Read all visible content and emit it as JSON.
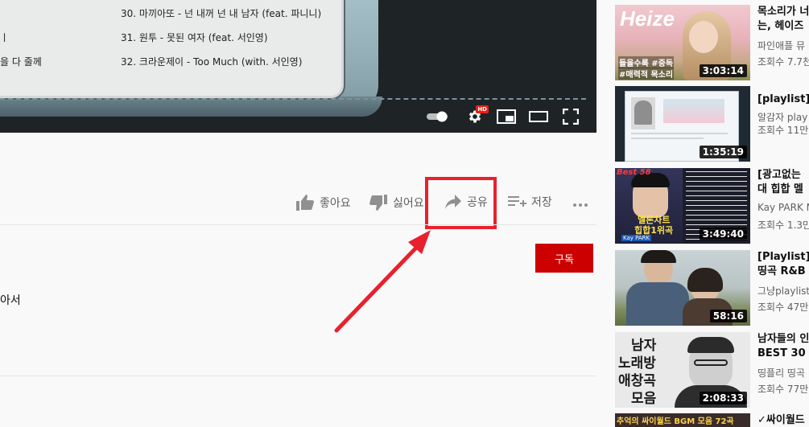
{
  "player": {
    "tracks": [
      {
        "label": "30. 마끼아또 - 넌 내꺼 넌 내 남자 (feat. 파니니)"
      },
      {
        "label": "31. 원투 - 못된 여자 (feat. 서인영)"
      },
      {
        "label": "32. 크라운제이 - Too Much (with. 서인영)"
      }
    ],
    "left_fragments": [
      "ㅣ",
      "을 다 줄께"
    ]
  },
  "actions": {
    "like_label": "좋아요",
    "dislike_label": "싫어요",
    "share_label": "공유",
    "save_label": "저장"
  },
  "channel": {
    "subscribe_label": "구독",
    "description_fragment": "아서"
  },
  "annotation": {
    "highlight_color": "#e8212d"
  },
  "recommendations": [
    {
      "title_line1": "목소리가 너",
      "title_line2": "는, 헤이즈",
      "channel": "파인애플 뮤",
      "views": "조회수 7.7천",
      "duration": "3:03:14",
      "thumb_text": [
        "Heize",
        "들을수록 #중독",
        "#매력적 목소리"
      ]
    },
    {
      "title_line1": "[playlist] 새",
      "title_line2": "",
      "channel": "알감자 play",
      "views": "조회수 11만",
      "duration": "1:35:19",
      "thumb_text": []
    },
    {
      "title_line1": "[광고없는",
      "title_line2": "대 힙합 멜",
      "channel": "Kay PARK M",
      "views": "조회수 1.3만",
      "duration": "3:49:40",
      "thumb_text": [
        "Best 58",
        "멜론차트",
        "힙합1위곡",
        "Kay PARK"
      ]
    },
    {
      "title_line1": "[Playlist] 오",
      "title_line2": "띵곡 R&B 플",
      "channel": "그냥playlist",
      "views": "조회수 47만",
      "duration": "58:16",
      "thumb_text": []
    },
    {
      "title_line1": "남자들의 인",
      "title_line2": "BEST 30 K",
      "channel": "띵플리 띵곡",
      "views": "조회수 77만",
      "duration": "2:08:33",
      "thumb_text": [
        "남자",
        "노래방",
        "애창곡",
        "모음"
      ]
    },
    {
      "title_line1": "✓싸이월드",
      "title_line2": "",
      "channel": "",
      "views": "",
      "duration": "",
      "thumb_text": [
        "추억의 싸이월드 BGM 모음 72곡"
      ]
    }
  ]
}
